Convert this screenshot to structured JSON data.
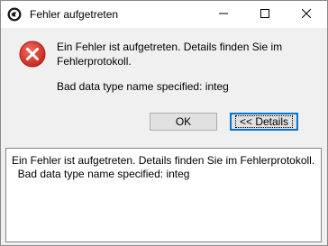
{
  "window": {
    "title": "Fehler aufgetreten"
  },
  "titlebar_controls": {
    "minimize_icon": "minimize-icon",
    "maximize_icon": "maximize-icon",
    "close_icon": "close-icon"
  },
  "dialog": {
    "icon": "error-icon",
    "message": "Ein Fehler ist aufgetreten. Details finden Sie im Fehlerprotokoll.",
    "detail": "Bad data type name specified: integ"
  },
  "buttons": {
    "ok_label": "OK",
    "details_label": "<< Details"
  },
  "details": {
    "text": "Ein Fehler ist aufgetreten. Details finden Sie im Fehlerprotokoll.\n  Bad data type name specified: integ"
  },
  "colors": {
    "error_red": "#d9342b",
    "focus_blue": "#0078d7"
  }
}
